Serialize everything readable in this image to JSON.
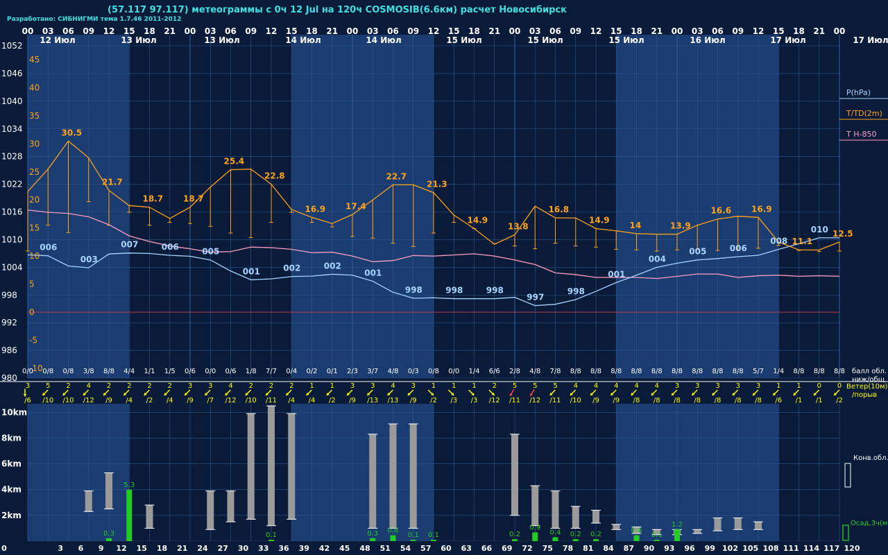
{
  "header": {
    "title": "(57.117 97.117) метеограммы с  0ч 12 Jul на 120ч COSMOSIB(6.6км) расчет Новосибирск",
    "credit": "Разработано: СИБНИГМИ тема 1.7.46 2011-2012"
  },
  "colors": {
    "background": "#0a1b3a",
    "band_light": "#1b3c70",
    "band_dark": "#0a1b3a",
    "pressure": "#a8d4ff",
    "temperature": "#ffa31a",
    "t850": "#ff9fc0",
    "grid": "#2c5a8c",
    "text": "#ffffff",
    "yellow": "#ffff00",
    "precip": "#22cc22",
    "cloud": "#9a9a9a"
  },
  "top_hours": [
    "00",
    "03",
    "06",
    "09",
    "12",
    "15",
    "18",
    "21",
    "00",
    "03",
    "06",
    "09",
    "12",
    "15",
    "18",
    "21",
    "00",
    "03",
    "06",
    "09",
    "12",
    "15",
    "18",
    "21",
    "00",
    "03",
    "06",
    "09",
    "12",
    "15",
    "18",
    "21",
    "00",
    "03",
    "06",
    "09",
    "12",
    "15",
    "18",
    "21",
    "00"
  ],
  "day_labels": [
    "12 Июл",
    "13 Июл",
    "13 Июл",
    "14 Июл",
    "14 Июл",
    "15 Июл",
    "15 Июл",
    "15 Июл",
    "16 Июл",
    "17 Июл",
    "17 Июл"
  ],
  "bottom_hours": [
    "0",
    "3",
    "6",
    "9",
    "12",
    "15",
    "18",
    "21",
    "24",
    "27",
    "30",
    "33",
    "36",
    "39",
    "42",
    "45",
    "48",
    "51",
    "54",
    "57",
    "60",
    "63",
    "66",
    "69",
    "72",
    "75",
    "78",
    "81",
    "84",
    "87",
    "90",
    "93",
    "96",
    "99",
    "102",
    "105",
    "108",
    "111",
    "114",
    "117",
    "120"
  ],
  "legend": {
    "pressure": "P(hPa)",
    "temperature": "T/TD(2m)",
    "t850": "T H-850",
    "clouds": "балл обл.",
    "clouds2": "ниж/общ",
    "wind": "Ветер(10м)",
    "wind2": "/порыв",
    "conv": "Конв.обл.",
    "precip": "Осад,3ч(мм)"
  },
  "chart_data": [
    {
      "type": "line",
      "title": "",
      "x_hours": [
        0,
        3,
        6,
        9,
        12,
        15,
        18,
        21,
        24,
        27,
        30,
        33,
        36,
        39,
        42,
        45,
        48,
        51,
        54,
        57,
        60,
        63,
        66,
        69,
        72,
        75,
        78,
        81,
        84,
        87,
        90,
        93,
        96,
        99,
        102,
        105,
        108,
        111,
        114,
        117,
        120
      ],
      "pressure_axis": {
        "ticks": [
          1052,
          1046,
          1040,
          1034,
          1028,
          1022,
          1016,
          1010,
          1004,
          998,
          992,
          986,
          980
        ]
      },
      "temperature_axis": {
        "ticks": [
          45,
          40,
          35,
          30,
          25,
          20,
          15,
          10,
          5,
          0,
          -5,
          -10
        ]
      },
      "series": [
        {
          "name": "P(hPa)",
          "values": [
            1006.7,
            1006.5,
            1004.3,
            1003.9,
            1006.9,
            1007.1,
            1007.0,
            1006.6,
            1006.4,
            1005.6,
            1003.2,
            1001.3,
            1001.5,
            1002.0,
            1002.1,
            1002.5,
            1002.3,
            1001.0,
            998.6,
            997.3,
            997.4,
            997.2,
            997.2,
            997.2,
            997.5,
            995.7,
            996.0,
            997.0,
            998.8,
            1000.7,
            1002.3,
            1004.0,
            1004.9,
            1005.6,
            1005.9,
            1006.3,
            1006.6,
            1007.9,
            1009.1,
            1010.4,
            1010.4
          ]
        },
        {
          "name": "T(2m)",
          "values": [
            21.5,
            25.5,
            30.5,
            27.5,
            21.7,
            19.0,
            18.7,
            16.7,
            18.7,
            22.3,
            25.4,
            25.5,
            22.8,
            18.3,
            16.9,
            15.8,
            17.4,
            20.0,
            22.7,
            22.7,
            21.3,
            17.3,
            14.9,
            12.1,
            13.8,
            18.9,
            16.8,
            16.8,
            14.9,
            14.5,
            14.0,
            13.9,
            13.9,
            15.5,
            16.6,
            17.1,
            16.9,
            12.5,
            11.1,
            11.1,
            12.5
          ]
        },
        {
          "name": "TD(2m)",
          "values": [
            10.9,
            15.5,
            14.2,
            19.7,
            15.5,
            17.8,
            15.5,
            16.0,
            15.8,
            15.3,
            14.1,
            13.3,
            16.0,
            17.8,
            16.0,
            15.2,
            13.5,
            13.2,
            12.3,
            11.7,
            14.1,
            16.0,
            14.9,
            12.2,
            11.8,
            11.3,
            12.3,
            11.8,
            11.6,
            11.2,
            11.1,
            10.9,
            11.1,
            11.2,
            11.0,
            11.1,
            11.4,
            11.9,
            11.0,
            10.8,
            10.9
          ]
        },
        {
          "name": "T H-850",
          "values": [
            18.2,
            17.8,
            17.6,
            17.0,
            15.6,
            13.6,
            12.6,
            11.8,
            11.3,
            10.7,
            10.8,
            11.6,
            11.5,
            11.2,
            10.6,
            10.7,
            10.0,
            9.0,
            9.2,
            10.1,
            10.0,
            10.2,
            10.4,
            10.0,
            9.3,
            8.5,
            7.0,
            6.7,
            6.2,
            6.2,
            6.2,
            6.0,
            6.4,
            6.8,
            6.8,
            6.2,
            6.5,
            6.6,
            6.4,
            6.5,
            6.4
          ]
        }
      ],
      "pressure_labels": [
        {
          "x": 3,
          "text": "006"
        },
        {
          "x": 9,
          "text": "003"
        },
        {
          "x": 15,
          "text": "007"
        },
        {
          "x": 21,
          "text": "006"
        },
        {
          "x": 27,
          "text": "005"
        },
        {
          "x": 33,
          "text": "001"
        },
        {
          "x": 39,
          "text": "002"
        },
        {
          "x": 45,
          "text": "002"
        },
        {
          "x": 51,
          "text": "001"
        },
        {
          "x": 57,
          "text": "998"
        },
        {
          "x": 63,
          "text": "998"
        },
        {
          "x": 69,
          "text": "998"
        },
        {
          "x": 75,
          "text": "997"
        },
        {
          "x": 81,
          "text": "998"
        },
        {
          "x": 87,
          "text": "001"
        },
        {
          "x": 93,
          "text": "004"
        },
        {
          "x": 99,
          "text": "005"
        },
        {
          "x": 105,
          "text": "006"
        },
        {
          "x": 111,
          "text": "008"
        },
        {
          "x": 117,
          "text": "010"
        }
      ],
      "temperature_labels": [
        {
          "x": 6,
          "text": "30.5"
        },
        {
          "x": 12,
          "text": "21.7"
        },
        {
          "x": 18,
          "text": "18.7"
        },
        {
          "x": 24,
          "text": "18.7"
        },
        {
          "x": 30,
          "text": "25.4"
        },
        {
          "x": 36,
          "text": "22.8"
        },
        {
          "x": 42,
          "text": "16.9"
        },
        {
          "x": 48,
          "text": "17.4"
        },
        {
          "x": 54,
          "text": "22.7"
        },
        {
          "x": 60,
          "text": "21.3"
        },
        {
          "x": 66,
          "text": "14.9"
        },
        {
          "x": 72,
          "text": "13.8"
        },
        {
          "x": 78,
          "text": "16.8"
        },
        {
          "x": 84,
          "text": "14.9"
        },
        {
          "x": 90,
          "text": "14"
        },
        {
          "x": 96,
          "text": "13.9"
        },
        {
          "x": 102,
          "text": "16.6"
        },
        {
          "x": 108,
          "text": "16.9"
        },
        {
          "x": 114,
          "text": "11.1"
        },
        {
          "x": 120,
          "text": "12.5"
        }
      ],
      "clouds": [
        "0/0",
        "0/8",
        "0/8",
        "3/8",
        "8/8",
        "4/4",
        "1/1",
        "1/5",
        "0/6",
        "0/0",
        "0/6",
        "1/8",
        "7/7",
        "0/4",
        "0/2",
        "0/1",
        "2/3",
        "3/7",
        "4/8",
        "0/3",
        "0/8",
        "0/0",
        "1/4",
        "6/6",
        "2/8",
        "4/8",
        "7/8",
        "8/8",
        "8/8",
        "8/8",
        "8/8",
        "8/8",
        "8/8",
        "8/8",
        "8/8",
        "8/8",
        "5/7",
        "1/4",
        "8/8",
        "8/8",
        "8/8"
      ],
      "wind_speed": [
        "3",
        "5",
        "2",
        "4",
        "2",
        "2",
        "2",
        "2",
        "3",
        "3",
        "4",
        "2",
        "2",
        "2",
        "1",
        "1",
        "3",
        "3",
        "4",
        "3",
        "1",
        "1",
        "1",
        "2",
        "5",
        "5",
        "5",
        "4",
        "4",
        "4",
        "4",
        "4",
        "3",
        "3",
        "3",
        "3",
        "3",
        "1",
        "1",
        "0",
        "0"
      ],
      "wind_gust": [
        "/6",
        "/10",
        "/10",
        "/12",
        "/9",
        "/4",
        "/2",
        "/4",
        "/9",
        "/7",
        "/12",
        "/10",
        "/11",
        "/4",
        "/4",
        "/2",
        "/9",
        "/13",
        "/13",
        "/9",
        "/2",
        "/3",
        "/3",
        "/12",
        "/11",
        "/12",
        "/11",
        "/10",
        "/9",
        "/9",
        "/8",
        "/8",
        "/8",
        "/8",
        "/8",
        "/8",
        "/8",
        "/6",
        "/1",
        "/1",
        "/2"
      ],
      "wind_dir_deg": [
        270,
        225,
        225,
        225,
        225,
        225,
        225,
        225,
        225,
        225,
        225,
        225,
        225,
        225,
        225,
        225,
        225,
        225,
        225,
        225,
        315,
        315,
        315,
        315,
        240,
        240,
        225,
        225,
        225,
        225,
        225,
        225,
        225,
        225,
        225,
        225,
        225,
        225,
        225,
        225,
        225
      ]
    },
    {
      "type": "bar",
      "title": "",
      "yaxis_ticks": [
        "10km",
        "8km",
        "6km",
        "4km",
        "2km"
      ],
      "ylim": [
        0,
        11
      ],
      "conv_clouds": [
        {
          "x": 9,
          "bottom": 2.3,
          "top": 3.9
        },
        {
          "x": 12,
          "bottom": 2.5,
          "top": 5.3
        },
        {
          "x": 18,
          "bottom": 1.0,
          "top": 2.8
        },
        {
          "x": 27,
          "bottom": 0.9,
          "top": 3.9
        },
        {
          "x": 30,
          "bottom": 1.5,
          "top": 3.9
        },
        {
          "x": 33,
          "bottom": 1.7,
          "top": 9.9
        },
        {
          "x": 36,
          "bottom": 1.2,
          "top": 10.5
        },
        {
          "x": 39,
          "bottom": 1.7,
          "top": 9.9
        },
        {
          "x": 51,
          "bottom": 1.0,
          "top": 8.3
        },
        {
          "x": 54,
          "bottom": 1.0,
          "top": 9.1
        },
        {
          "x": 57,
          "bottom": 1.0,
          "top": 9.1
        },
        {
          "x": 72,
          "bottom": 2.0,
          "top": 8.3
        },
        {
          "x": 75,
          "bottom": 1.2,
          "top": 4.3
        },
        {
          "x": 78,
          "bottom": 1.0,
          "top": 3.9
        },
        {
          "x": 81,
          "bottom": 1.0,
          "top": 2.7
        },
        {
          "x": 84,
          "bottom": 1.4,
          "top": 2.4
        },
        {
          "x": 87,
          "bottom": 0.9,
          "top": 1.3
        },
        {
          "x": 90,
          "bottom": 0.6,
          "top": 1.1
        },
        {
          "x": 93,
          "bottom": 0.5,
          "top": 0.9
        },
        {
          "x": 96,
          "bottom": 0.5,
          "top": 0.9
        },
        {
          "x": 99,
          "bottom": 0.6,
          "top": 0.9
        },
        {
          "x": 102,
          "bottom": 0.8,
          "top": 1.8
        },
        {
          "x": 105,
          "bottom": 0.9,
          "top": 1.8
        },
        {
          "x": 108,
          "bottom": 0.9,
          "top": 1.5
        }
      ],
      "precip": [
        {
          "x": 12,
          "value": 0.3
        },
        {
          "x": 15,
          "value": 5.3
        },
        {
          "x": 36,
          "value": 0.1
        },
        {
          "x": 51,
          "value": 0.3
        },
        {
          "x": 54,
          "value": 0.6
        },
        {
          "x": 57,
          "value": 0.1
        },
        {
          "x": 60,
          "value": 0.1
        },
        {
          "x": 72,
          "value": 0.2
        },
        {
          "x": 75,
          "value": 0.9
        },
        {
          "x": 78,
          "value": 0.4
        },
        {
          "x": 81,
          "value": 0.2
        },
        {
          "x": 84,
          "value": 0.2
        },
        {
          "x": 90,
          "value": 0.6
        },
        {
          "x": 93,
          "value": 0.1
        },
        {
          "x": 96,
          "value": 1.2
        }
      ]
    }
  ]
}
